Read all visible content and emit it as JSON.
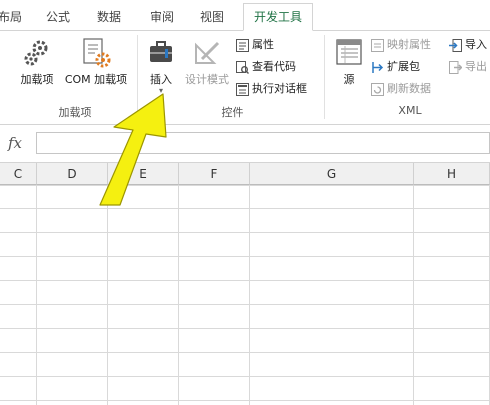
{
  "tabs": {
    "items": [
      "布局",
      "公式",
      "数据",
      "审阅",
      "视图"
    ],
    "active": "开发工具"
  },
  "ribbon": {
    "addins_group": {
      "label": "加载项",
      "addins_button": "加载项",
      "com_addins_button": "COM 加载项"
    },
    "controls_group": {
      "label": "控件",
      "insert_button": "插入",
      "design_mode_button": "设计模式",
      "properties_button": "属性",
      "view_code_button": "查看代码",
      "run_dialog_button": "执行对话框"
    },
    "xml_group": {
      "label": "XML",
      "source_button": "源",
      "map_properties_button": "映射属性",
      "expansion_packs_button": "扩展包",
      "refresh_data_button": "刷新数据",
      "import_button": "导入",
      "export_button": "导出"
    }
  },
  "formula_bar": {
    "fx_label": "fx",
    "value": ""
  },
  "sheet": {
    "columns": [
      "C",
      "D",
      "E",
      "F",
      "G",
      "H"
    ]
  },
  "colors": {
    "accent_green": "#217346",
    "annotation_arrow": "#f5f010"
  }
}
